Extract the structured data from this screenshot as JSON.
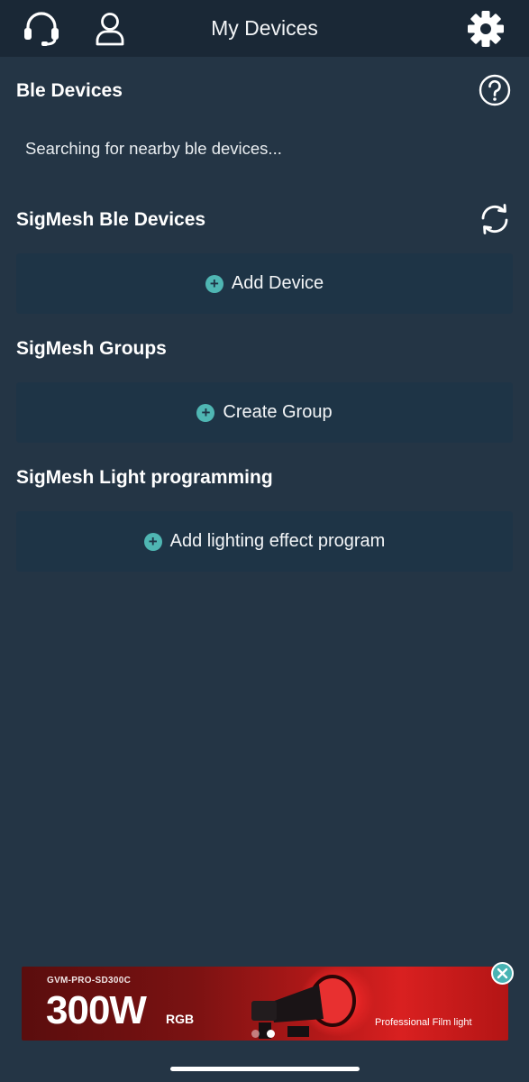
{
  "header": {
    "title": "My Devices",
    "icons": [
      "headset-icon",
      "user-icon",
      "gear-icon"
    ]
  },
  "sections": {
    "ble": {
      "title": "Ble Devices",
      "status": "Searching for nearby ble devices...",
      "icon": "help-icon"
    },
    "sigmesh_devices": {
      "title": "SigMesh Ble Devices",
      "action_label": "Add Device",
      "icon": "refresh-icon"
    },
    "sigmesh_groups": {
      "title": "SigMesh Groups",
      "action_label": "Create Group"
    },
    "sigmesh_programming": {
      "title": "SigMesh Light programming",
      "action_label": "Add lighting effect program"
    }
  },
  "ad_banner": {
    "model": "GVM-PRO-SD300C",
    "power": "300W",
    "mode": "RGB",
    "tagline": "Professional Film light",
    "slide_count": 2,
    "active_slide": 2
  },
  "colors": {
    "background": "#243545",
    "header": "#1a2836",
    "card": "#1e3446",
    "accent": "#4fb6b3"
  }
}
